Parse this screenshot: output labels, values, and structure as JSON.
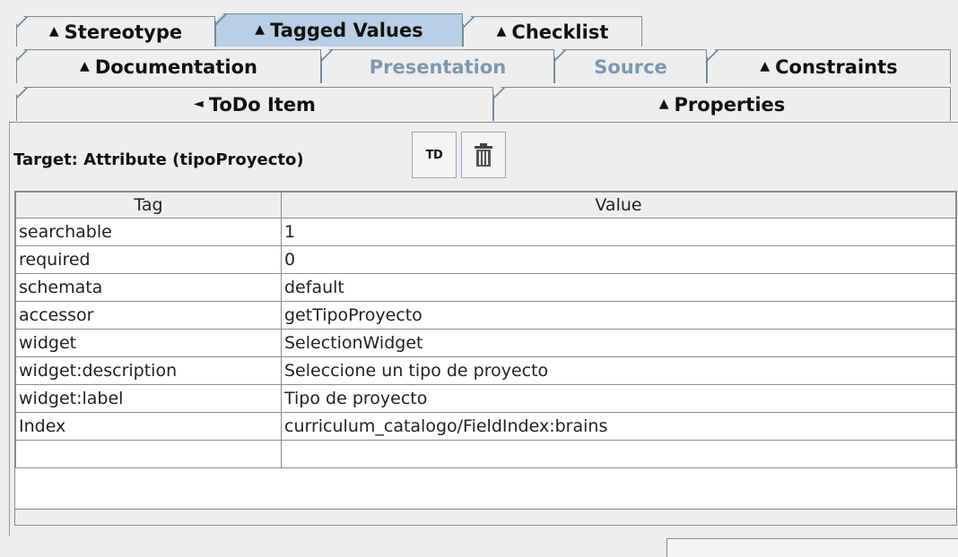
{
  "tabs": {
    "row1": [
      {
        "label": "Stereotype",
        "arrow": "▲",
        "state": "normal"
      },
      {
        "label": "Tagged Values",
        "arrow": "▲",
        "state": "selected"
      },
      {
        "label": "Checklist",
        "arrow": "▲",
        "state": "normal"
      }
    ],
    "row2": [
      {
        "label": "Documentation",
        "arrow": "▲",
        "state": "normal"
      },
      {
        "label": "Presentation",
        "arrow": "",
        "state": "disabled"
      },
      {
        "label": "Source",
        "arrow": "",
        "state": "disabled"
      },
      {
        "label": "Constraints",
        "arrow": "▲",
        "state": "normal"
      }
    ],
    "row3": [
      {
        "label": "ToDo Item",
        "arrow": "◄",
        "state": "normal"
      },
      {
        "label": "Properties",
        "arrow": "▲",
        "state": "normal"
      }
    ]
  },
  "toolbar": {
    "target_label": "Target: Attribute (tipoProyecto)",
    "new_td_label": "TD",
    "delete_icon": "trash-icon"
  },
  "table": {
    "headers": [
      "Tag",
      "Value"
    ],
    "rows": [
      {
        "tag": "searchable",
        "value": "1"
      },
      {
        "tag": "required",
        "value": "0"
      },
      {
        "tag": "schemata",
        "value": "default"
      },
      {
        "tag": "accessor",
        "value": "getTipoProyecto"
      },
      {
        "tag": "widget",
        "value": "SelectionWidget"
      },
      {
        "tag": "widget:description",
        "value": "Seleccione un tipo de proyecto"
      },
      {
        "tag": "widget:label",
        "value": "Tipo de proyecto"
      },
      {
        "tag": "Index",
        "value": "curriculum_catalogo/FieldIndex:brains"
      },
      {
        "tag": "",
        "value": ""
      }
    ]
  },
  "colors": {
    "selected_tab": "#b8cfe5",
    "disabled_tab_text": "#7e98b0",
    "border": "#7a8a99"
  }
}
